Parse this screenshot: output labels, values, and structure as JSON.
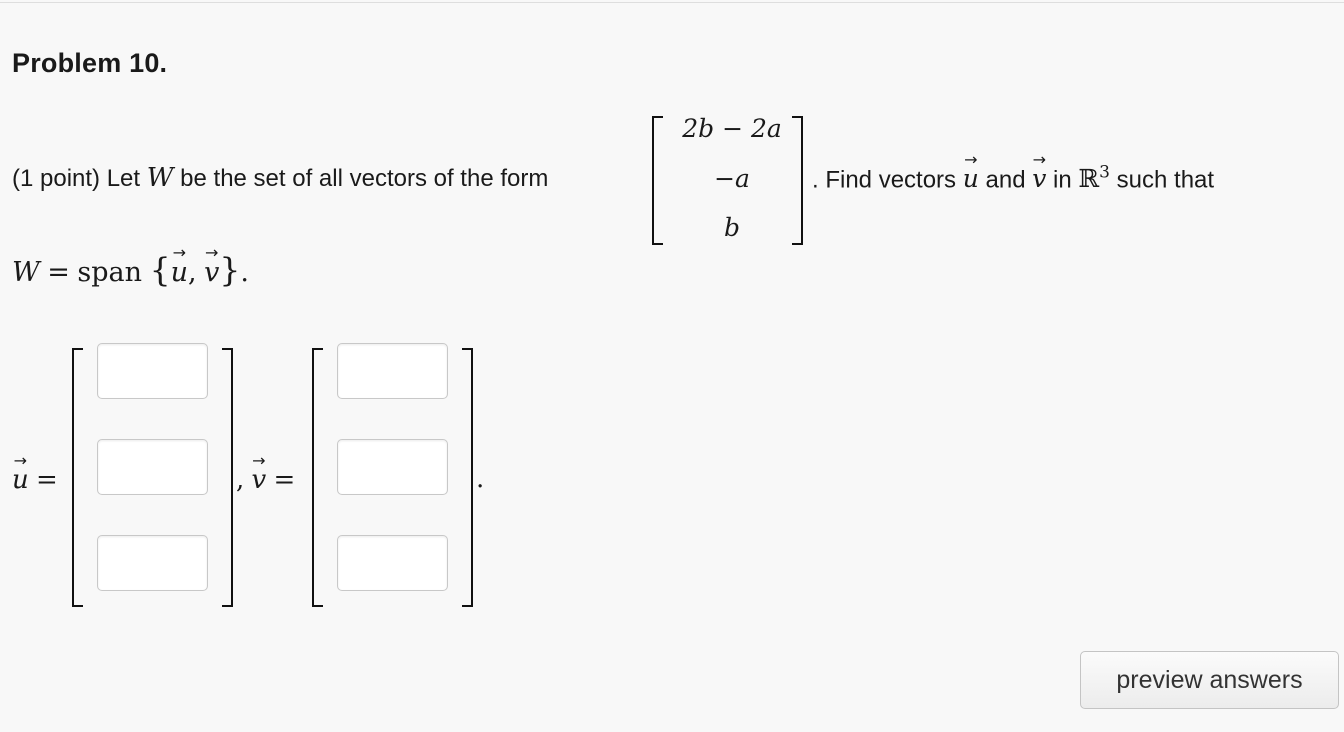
{
  "problem": {
    "title": "Problem 10.",
    "intro_text": "(1 point) Let",
    "set_name": "W",
    "intro_text_2": "be the set of all vectors of the form",
    "matrix_entries": [
      "2b − 2a",
      "−a",
      "b"
    ],
    "find_text": ". Find vectors",
    "u_symbol": "u",
    "and_text": "and",
    "v_symbol": "v",
    "in_text": "in",
    "real_space": "ℝ",
    "real_space_exponent": "3",
    "such_that_text": "such that",
    "span_equation": {
      "lhs": "W",
      "equals": "=",
      "span_word": "span",
      "open_brace": "{",
      "u": "u",
      "comma": ",",
      "v": "v",
      "close_brace": "}",
      "period": "."
    }
  },
  "answers": {
    "u_label": "u",
    "v_label": "v",
    "equals": "=",
    "separator": ",",
    "end_period": ".",
    "u_values": [
      "",
      "",
      ""
    ],
    "v_values": [
      "",
      "",
      ""
    ]
  },
  "actions": {
    "preview_label": "preview answers"
  }
}
